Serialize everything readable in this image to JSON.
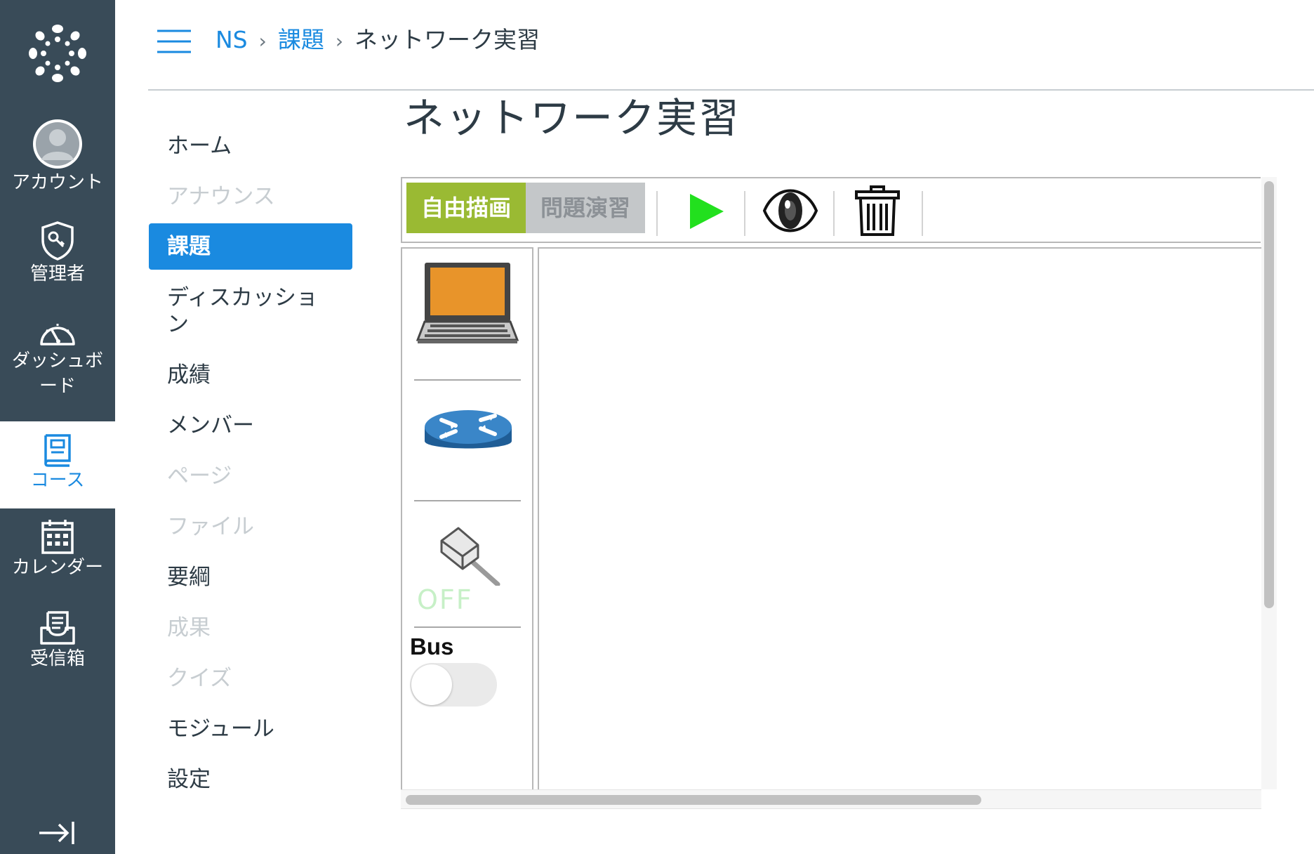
{
  "global_nav": {
    "items": [
      {
        "id": "account",
        "label": "アカウント",
        "icon": "avatar-icon"
      },
      {
        "id": "admin",
        "label": "管理者",
        "icon": "shield-key-icon"
      },
      {
        "id": "dashboard",
        "label": "ダッシュボード",
        "icon": "speedometer-icon"
      },
      {
        "id": "courses",
        "label": "コース",
        "icon": "book-icon"
      },
      {
        "id": "calendar",
        "label": "カレンダー",
        "icon": "calendar-icon"
      },
      {
        "id": "inbox",
        "label": "受信箱",
        "icon": "inbox-icon"
      }
    ],
    "active": "courses",
    "colors": {
      "bg": "#394b58",
      "active_text": "#1a8ae0"
    }
  },
  "breadcrumb": {
    "course": "NS",
    "section": "課題",
    "current": "ネットワーク実習"
  },
  "course_nav": {
    "items": [
      {
        "label": "ホーム",
        "state": "normal"
      },
      {
        "label": "アナウンス",
        "state": "disabled"
      },
      {
        "label": "課題",
        "state": "active"
      },
      {
        "label": "ディスカッション",
        "state": "normal"
      },
      {
        "label": "成績",
        "state": "normal"
      },
      {
        "label": "メンバー",
        "state": "normal"
      },
      {
        "label": "ページ",
        "state": "disabled"
      },
      {
        "label": "ファイル",
        "state": "disabled"
      },
      {
        "label": "要綱",
        "state": "normal"
      },
      {
        "label": "成果",
        "state": "disabled"
      },
      {
        "label": "クイズ",
        "state": "disabled"
      },
      {
        "label": "モジュール",
        "state": "normal"
      },
      {
        "label": "設定",
        "state": "normal"
      }
    ]
  },
  "page": {
    "title": "ネットワーク実習"
  },
  "editor": {
    "mode_free": "自由描画",
    "mode_problem": "問題演習",
    "active_mode": "自由描画",
    "toolbar_icons": [
      "play-icon",
      "eye-icon",
      "trash-icon"
    ],
    "palette": {
      "items": [
        "laptop-icon",
        "router-icon",
        "cable-plug-icon"
      ],
      "cable_state": "OFF",
      "bus_label": "Bus",
      "bus_on": false
    },
    "colors": {
      "free_mode": "#9aba33",
      "problem_mode": "#c4c7c9",
      "play": "#22e01e",
      "laptop_screen": "#e8942a",
      "router": "#2e6ea6"
    }
  }
}
